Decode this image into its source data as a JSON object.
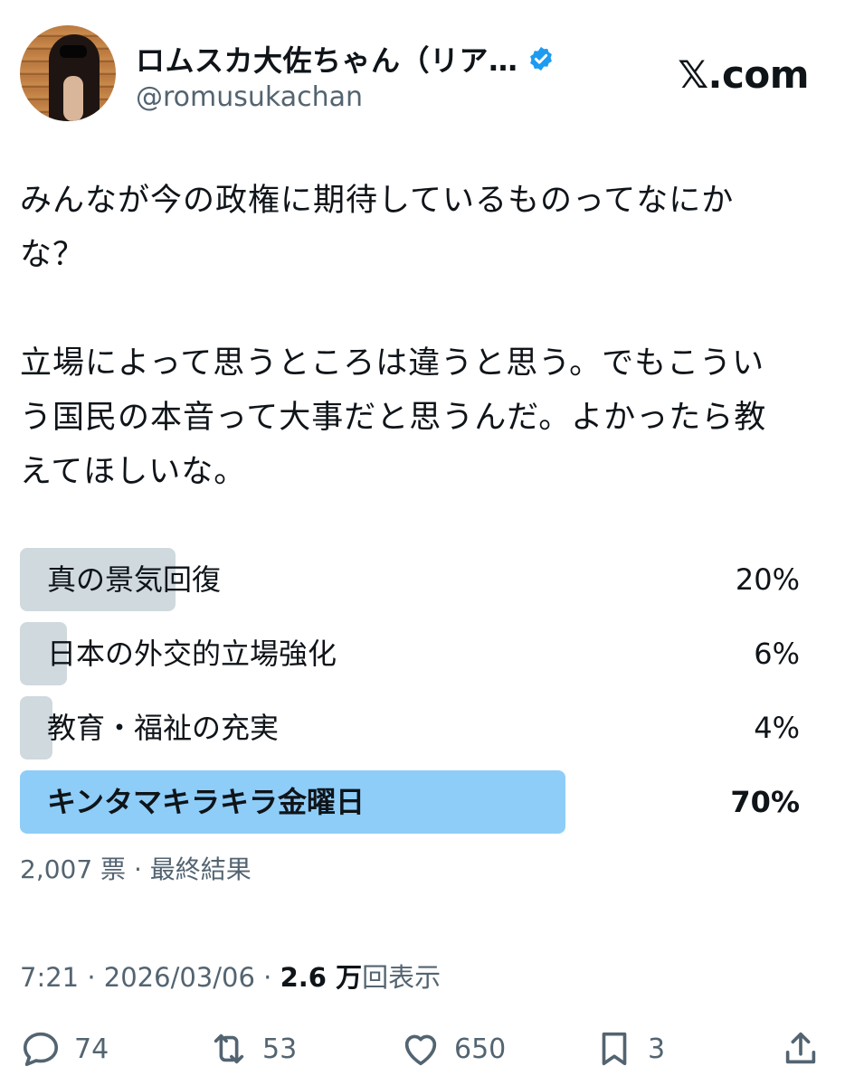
{
  "header": {
    "display_name": "ロムスカ大佐ちゃん（リア…",
    "handle": "@romusukachan",
    "site": "𝕏.com",
    "verified_icon": "verified-badge-icon",
    "verified_color": "#1d9bf0"
  },
  "tweet": {
    "text": "みんなが今の政権に期待しているものってなにか\nな？\n\n立場によって思うところは違うと思う。でもこうい\nう国民の本音って大事だと思うんだ。よかったら教\nえてほしいな。"
  },
  "poll": {
    "options": [
      {
        "label": "真の景気回復",
        "percent": "20%",
        "value": 20,
        "winner": false
      },
      {
        "label": "日本の外交的立場強化",
        "percent": "6%",
        "value": 6,
        "winner": false
      },
      {
        "label": "教育・福祉の充実",
        "percent": "4%",
        "value": 4,
        "winner": false
      },
      {
        "label": "キンタマキラキラ金曜日",
        "percent": "70%",
        "value": 70,
        "winner": true
      }
    ],
    "meta": "2,007 票 · 最終結果",
    "bar_color": "#cfd9de",
    "winner_color": "#8ecdf8"
  },
  "timestamp": {
    "time_date": "7:21 · 2026/03/06 · ",
    "views_count": "2.6 万",
    "views_label": "回表示"
  },
  "actions": {
    "reply": {
      "icon": "reply-icon",
      "count": "74"
    },
    "repost": {
      "icon": "repost-icon",
      "count": "53"
    },
    "like": {
      "icon": "heart-icon",
      "count": "650"
    },
    "bookmark": {
      "icon": "bookmark-icon",
      "count": "3"
    },
    "share": {
      "icon": "share-icon"
    }
  }
}
